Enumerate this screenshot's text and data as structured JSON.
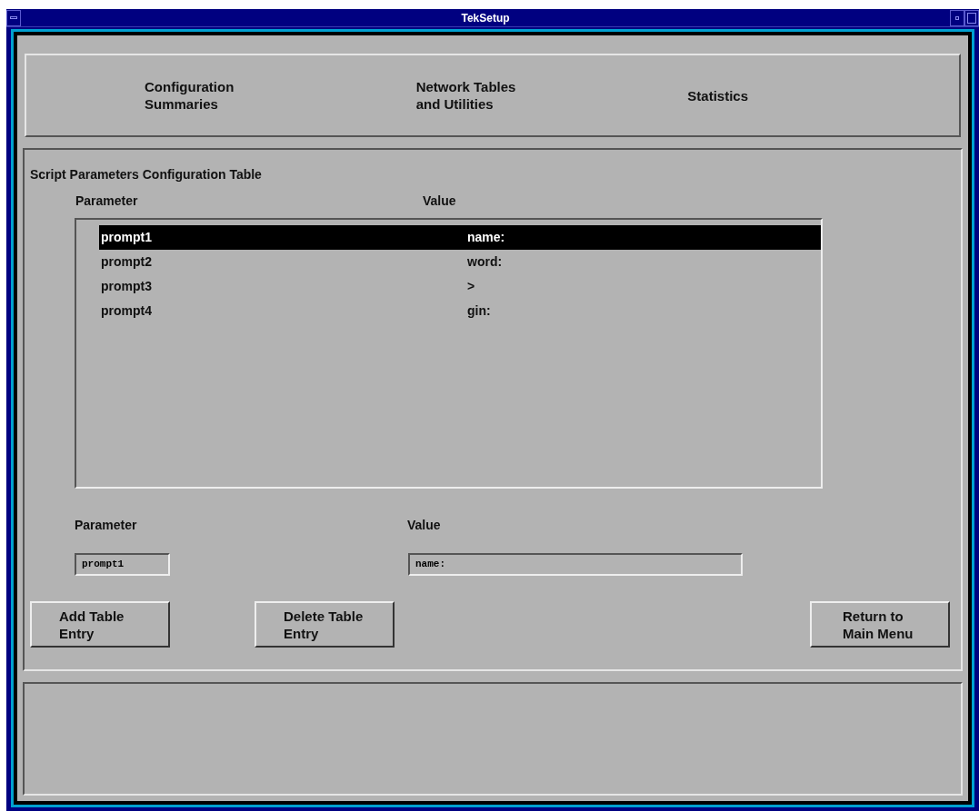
{
  "window": {
    "title": "TekSetup"
  },
  "nav_buttons": [
    {
      "label": "Configuration\nSummaries"
    },
    {
      "label": "Network Tables\nand Utilities"
    },
    {
      "label": "Statistics"
    }
  ],
  "panel_title": "Script Parameters Configuration Table",
  "list": {
    "columns": [
      "Parameter",
      "Value"
    ],
    "rows": [
      {
        "parameter": "prompt1",
        "value": "name:",
        "selected": true
      },
      {
        "parameter": "prompt2",
        "value": "word:",
        "selected": false
      },
      {
        "parameter": "prompt3",
        "value": ">",
        "selected": false
      },
      {
        "parameter": "prompt4",
        "value": "gin:",
        "selected": false
      }
    ]
  },
  "fields": [
    {
      "label": "Parameter",
      "value": "prompt1"
    },
    {
      "label": "Value",
      "value": "name:"
    }
  ],
  "buttons": [
    {
      "label": "Add Table\nEntry"
    },
    {
      "label": "Delete Table\nEntry"
    },
    {
      "label": "Return to\nMain Menu"
    }
  ]
}
